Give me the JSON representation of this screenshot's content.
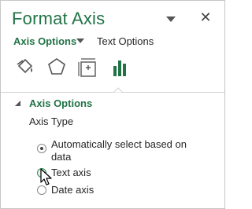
{
  "pane": {
    "title": "Format Axis",
    "pin_icon": "pin-dropdown-icon",
    "close_icon": "close-icon",
    "close_glyph": "✕"
  },
  "tabs": {
    "axis_options": "Axis Options",
    "text_options": "Text Options"
  },
  "icon_tabs": [
    "fill-line-icon",
    "effects-icon",
    "size-properties-icon",
    "axis-options-chart-icon"
  ],
  "section": {
    "title": "Axis Options",
    "expanded": true,
    "axis_type_label": "Axis Type",
    "options": [
      {
        "label_line1": "Automatically select based on",
        "label_line2": "data",
        "checked": true
      },
      {
        "label_line1": "Text axis",
        "label_line2": "",
        "checked": false,
        "hovered": true
      },
      {
        "label_line1": "Date axis",
        "label_line2": "",
        "checked": false
      }
    ]
  },
  "colors": {
    "accent": "#217346",
    "text": "#262626",
    "chart_icon": "#217346"
  }
}
